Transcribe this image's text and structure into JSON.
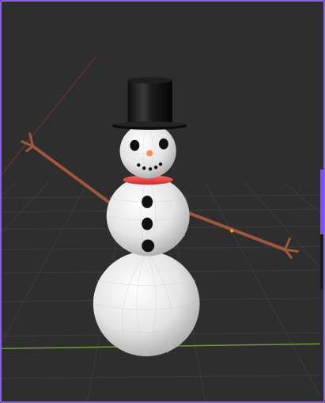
{
  "viewport": {
    "object_name": "Snowman",
    "background_color": "#2e2e2e",
    "grid_color": "#3d3d3d",
    "axis_x_color": "#8a3b3b",
    "axis_y_color": "#6f9a3a",
    "accent_color": "#8a5cf6",
    "parts": {
      "hat": "top-hat",
      "head": "head-sphere",
      "nose": "carrot-nose",
      "scarf": "red-scarf",
      "body": "middle-sphere",
      "base": "base-sphere",
      "arms": "stick-arms",
      "buttons": 3,
      "mouth_dots": 5
    }
  }
}
